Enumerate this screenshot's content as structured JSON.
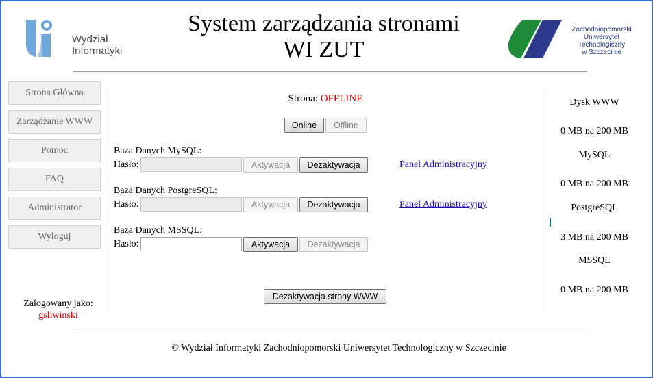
{
  "header": {
    "title_line1": "System zarządzania stronami",
    "title_line2": "WI ZUT",
    "logo_left": {
      "line1": "Wydział",
      "line2": "Informatyki",
      "icon": "wi-logo-icon"
    },
    "logo_right": {
      "line1": "Zachodniopomorski",
      "line2": "Uniwersytet",
      "line3": "Technologiczny",
      "line4": "w Szczecinie",
      "icon": "zut-logo-icon"
    }
  },
  "sidebar": {
    "items": [
      {
        "label": "Strona Główna"
      },
      {
        "label": "Zarządzanie WWW"
      },
      {
        "label": "Pomoc"
      },
      {
        "label": "FAQ"
      },
      {
        "label": "Administrator"
      },
      {
        "label": "Wyloguj"
      }
    ],
    "logged_label": "Zalogowany jako:",
    "username": "gsliwinski"
  },
  "main": {
    "status_label": "Strona:",
    "status_value": "OFFLINE",
    "online_btn": "Online",
    "offline_btn": "Offline",
    "password_label": "Hasło:",
    "databases": [
      {
        "label": "Baza Danych MySQL:",
        "activate": "Aktywacja",
        "deactivate": "Dezaktywacja",
        "link": "Panel Administracyjny"
      },
      {
        "label": "Baza Danych PostgreSQL:",
        "activate": "Aktywacja",
        "deactivate": "Dezaktywacja",
        "link": "Panel Administracyjny"
      },
      {
        "label": "Baza Danych MSSQL:",
        "activate": "Aktywacja",
        "deactivate": "Dezaktywacja"
      }
    ],
    "deactivate_site_btn": "Dezaktywacja strony WWW"
  },
  "usage": {
    "disk_title": "Dysk WWW",
    "disk_value": "0 MB na 200 MB",
    "mysql_title": "MySQL",
    "mysql_value": "0 MB na 200 MB",
    "pg_title": "PostgreSQL",
    "pg_value": "3 MB na 200 MB",
    "mssql_title": "MSSQL",
    "mssql_value": "0 MB na 200 MB"
  },
  "footer": {
    "text": "© Wydział Informatyki Zachodniopomorski Uniwersytet Technologiczny w Szczecinie"
  },
  "colors": {
    "offline": "#e00000",
    "username": "#d00000",
    "link": "#1a0dab",
    "zut_green": "#1f8a3a",
    "zut_blue": "#2b3a8a",
    "wi_blue": "#6fa8dc"
  }
}
